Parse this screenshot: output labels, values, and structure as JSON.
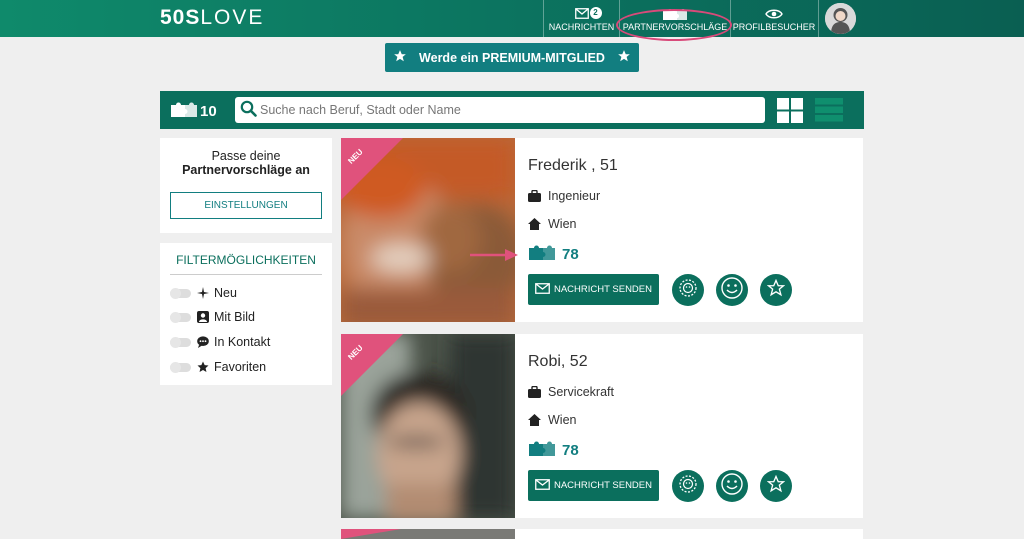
{
  "header": {
    "logo_bold": "50S",
    "logo_light": "LOVE",
    "nav": [
      {
        "label": "NACHRICHTEN",
        "icon": "envelope-icon",
        "badge": "2"
      },
      {
        "label": "PARTNERVORSCHLÄGE",
        "icon": "puzzle-icon"
      },
      {
        "label": "PROFILBESUCHER",
        "icon": "eye-icon"
      }
    ],
    "highlight_color": "#d84a7a"
  },
  "premium": {
    "label": "Werde ein PREMIUM-MITGLIED"
  },
  "search": {
    "count": "10",
    "placeholder": "Suche nach Beruf, Stadt oder Name"
  },
  "sidebar": {
    "settings_text_1": "Passe deine",
    "settings_text_2": "Partnervorschläge an",
    "settings_button": "EINSTELLUNGEN",
    "filters_title": "FILTERMÖGLICHKEITEN",
    "filters": [
      {
        "label": "Neu",
        "icon": "sparkle-icon"
      },
      {
        "label": "Mit Bild",
        "icon": "portrait-icon"
      },
      {
        "label": "In Kontakt",
        "icon": "chat-icon"
      },
      {
        "label": "Favoriten",
        "icon": "star-icon"
      }
    ]
  },
  "cards": [
    {
      "ribbon": "NEU",
      "name": "Frederik , 51",
      "job": "Ingenieur",
      "city": "Wien",
      "score": "78",
      "message_button": "NACHRICHT SENDEN"
    },
    {
      "ribbon": "NEU",
      "name": "Robi, 52",
      "job": "Servicekraft",
      "city": "Wien",
      "score": "78",
      "message_button": "NACHRICHT SENDEN"
    }
  ],
  "colors": {
    "primary": "#0b6f5d",
    "accent_teal": "#127e80",
    "ribbon": "#e0527c"
  }
}
